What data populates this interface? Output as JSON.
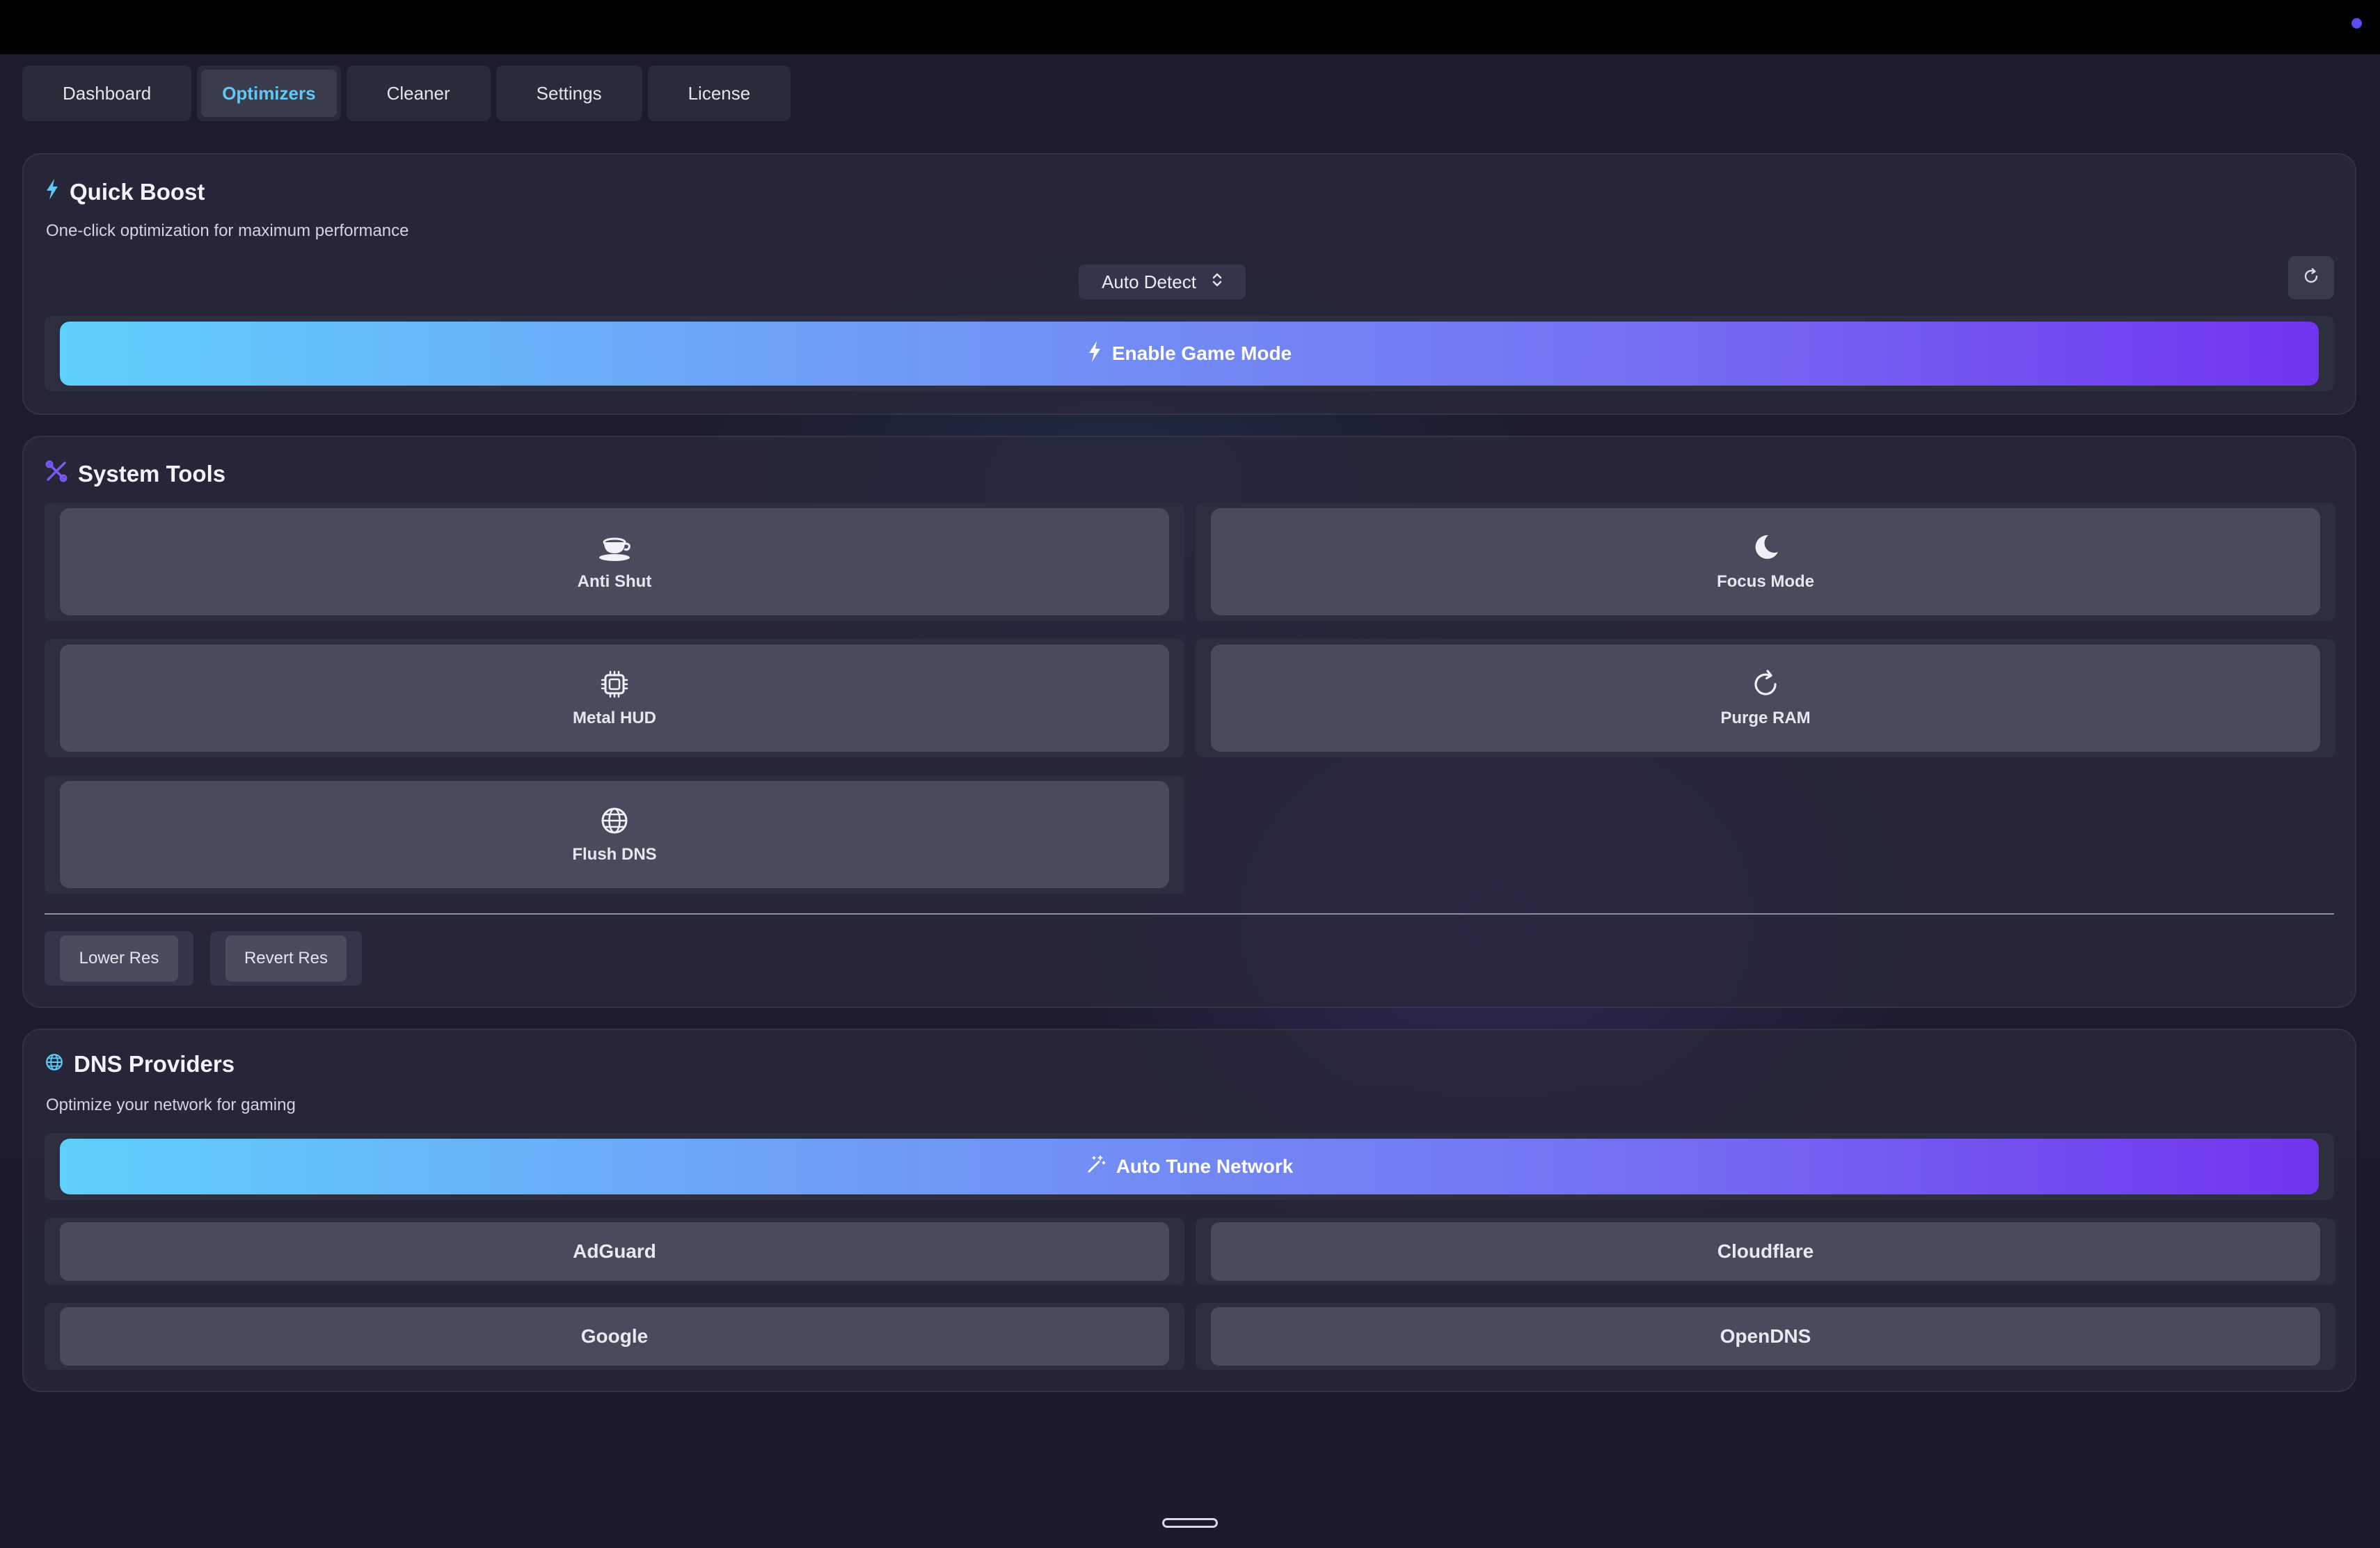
{
  "tabs": [
    {
      "label": "Dashboard"
    },
    {
      "label": "Optimizers"
    },
    {
      "label": "Cleaner"
    },
    {
      "label": "Settings"
    },
    {
      "label": "License"
    }
  ],
  "active_tab": "Optimizers",
  "quick_boost": {
    "title": "Quick Boost",
    "subtitle": "One-click optimization for maximum performance",
    "mode_select": "Auto Detect",
    "enable_button": "Enable Game Mode"
  },
  "system_tools": {
    "title": "System Tools",
    "tools": [
      {
        "label": "Anti Shut",
        "icon": "cup-icon"
      },
      {
        "label": "Focus Mode",
        "icon": "moon-icon"
      },
      {
        "label": "Metal HUD",
        "icon": "chip-icon"
      },
      {
        "label": "Purge RAM",
        "icon": "refresh-icon"
      },
      {
        "label": "Flush DNS",
        "icon": "globe-icon"
      }
    ],
    "res_buttons": [
      "Lower Res",
      "Revert Res"
    ]
  },
  "dns": {
    "title": "DNS Providers",
    "subtitle": "Optimize your network for gaming",
    "auto_button": "Auto Tune Network",
    "providers": [
      "AdGuard",
      "Cloudflare",
      "Google",
      "OpenDNS"
    ]
  },
  "colors": {
    "accent_cyan": "#5fd0fa",
    "accent_purple": "#7134f0",
    "active_tab_text": "#5fc9f6"
  }
}
